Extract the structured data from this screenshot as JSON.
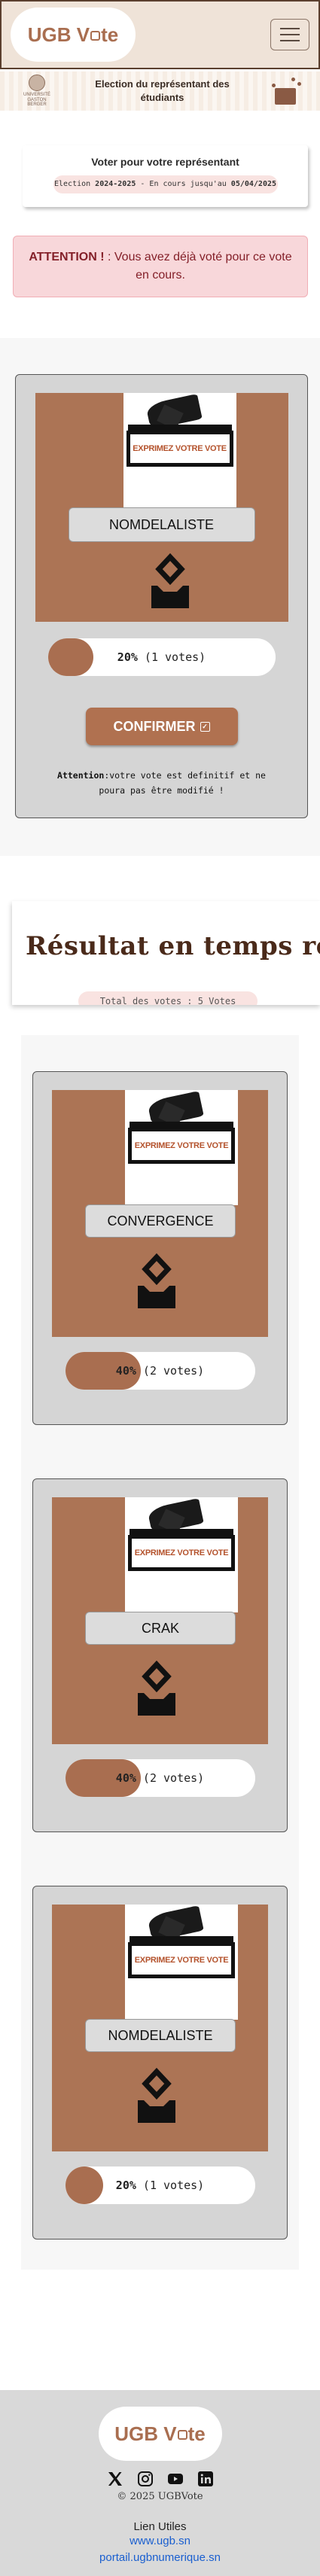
{
  "navbar": {
    "brand_prefix": "UGB V",
    "brand_suffix": "te",
    "menu_icon": "hamburger-icon"
  },
  "banner": {
    "title_line1": "Election du représentant des",
    "title_line2": "étudiants",
    "logo_text_line1": "UNIVERSITÉ",
    "logo_text_line2": "GASTON BERGER"
  },
  "vote_header": {
    "title": "Voter pour votre représentant",
    "period_prefix": "Election ",
    "year": "2024-2025",
    "period_mid": " - En cours jusqu'au ",
    "end_date": "05/04/2025"
  },
  "alert": {
    "strong": "ATTENTION !",
    "message": " : Vous avez déjà voté pour ce vote en cours."
  },
  "vote_card": {
    "poster_text": "EXPRIMEZ VOTRE VOTE",
    "candidate_name": "NOMDELALISTE",
    "percent": "20%",
    "votes": "(1 votes)",
    "fill_percent": 20,
    "confirm_label": "CONFIRMER",
    "warning_strong": "Attention",
    "warning_text": ":votre vote est definitif et ne poura pas être modifié !"
  },
  "results": {
    "title": "Résultat en temps réel",
    "total": "Total des votes : 5 Votes",
    "items": [
      {
        "name": "CONVERGENCE",
        "percent": "40%",
        "votes": "(2 votes)",
        "fill_percent": 40,
        "poster_text": "EXPRIMEZ VOTRE VOTE"
      },
      {
        "name": "CRAK",
        "percent": "40%",
        "votes": "(2 votes)",
        "fill_percent": 40,
        "poster_text": "EXPRIMEZ VOTRE VOTE"
      },
      {
        "name": "NOMDELALISTE",
        "percent": "20%",
        "votes": "(1 votes)",
        "fill_percent": 20,
        "poster_text": "EXPRIMEZ VOTRE VOTE"
      }
    ]
  },
  "footer": {
    "brand_prefix": "UGB V",
    "brand_suffix": "te",
    "copyright": "© 2025 UGBVote",
    "links_title": "Lien Utiles",
    "links": [
      "www.ugb.sn",
      "portail.ugbnumerique.sn"
    ],
    "social_icons": [
      "x-icon",
      "instagram-icon",
      "youtube-icon",
      "linkedin-icon"
    ]
  },
  "colors": {
    "brand": "#a96e50",
    "card_bg": "#d5d5d5",
    "alert_bg": "#f8d7da",
    "alert_text": "#842029",
    "link": "#1a5fd0"
  }
}
